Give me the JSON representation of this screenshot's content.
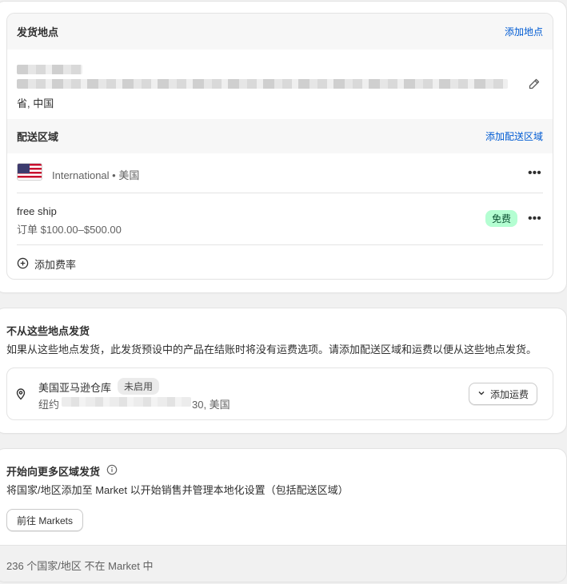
{
  "ship_from": {
    "header_title": "发货地点",
    "add_location_link": "添加地点",
    "address_tail": "省, 中国"
  },
  "zones": {
    "header_title": "配送区域",
    "add_zone_link": "添加配送区域",
    "zone_name": "International • 美国",
    "flag_icon": "us-flag-icon"
  },
  "rate": {
    "name": "free ship",
    "condition": "订单 $100.00–$500.00",
    "badge": "免费",
    "add_rate_label": "添加费率"
  },
  "not_shipping": {
    "title": "不从这些地点发货",
    "description": "如果从这些地点发货，此发货预设中的产品在结账时将没有运费选项。请添加配送区域和运费以便从这些地点发货。",
    "location_name": "美国亚马逊仓库",
    "status_badge": "未启用",
    "address_start": "纽约",
    "address_end": "30, 美国",
    "add_rate_button": "添加运费"
  },
  "markets": {
    "title": "开始向更多区域发货",
    "description": "将国家/地区添加至 Market 以开始销售并管理本地化设置（包括配送区域）",
    "button": "前往 Markets",
    "footer_text": "236 个国家/地区 不在 Market 中"
  },
  "colors": {
    "link": "#005bd3",
    "badge_free_bg": "#b4fed2",
    "page_bg": "#f1f1f1"
  }
}
